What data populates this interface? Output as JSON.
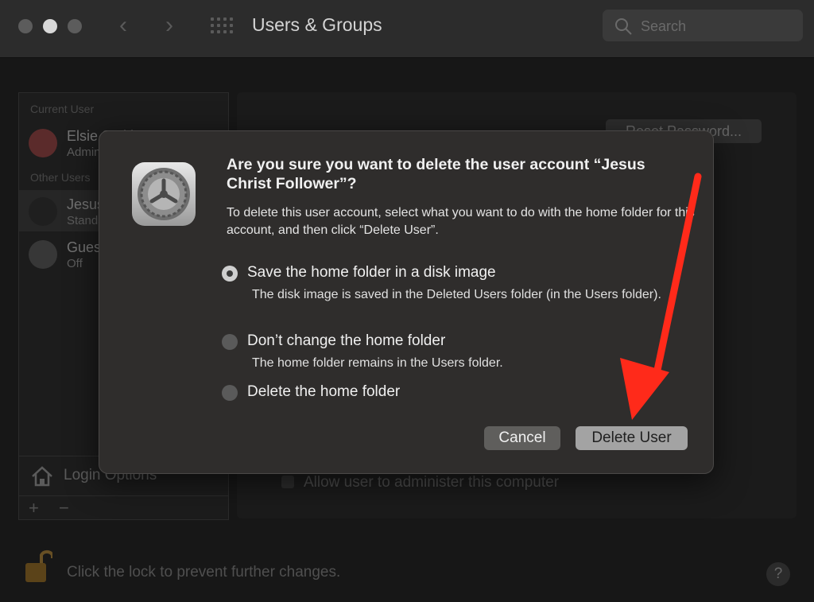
{
  "window": {
    "title": "Users & Groups",
    "search_placeholder": "Search"
  },
  "sidebar": {
    "current_user_label": "Current User",
    "current_user": {
      "name": "Elsie Smith",
      "role": "Admin"
    },
    "other_users_label": "Other Users",
    "other_users": [
      {
        "name": "Jesus Christ Follower",
        "role": "Standard"
      },
      {
        "name": "Guest User",
        "role": "Off"
      }
    ],
    "login_options": "Login Options",
    "add_label": "+",
    "remove_label": "−"
  },
  "panel": {
    "reset_password": "Reset Password...",
    "allow_admin": "Allow user to administer this computer"
  },
  "footer": {
    "lock_text": "Click the lock to prevent further changes.",
    "help": "?"
  },
  "dialog": {
    "title": "Are you sure you want to delete the user account “Jesus Christ Follower”?",
    "description": "To delete this user account, select what you want to do with the home folder for this account, and then click “Delete User”.",
    "options": [
      {
        "label": "Save the home folder in a disk image",
        "description": "The disk image is saved in the Deleted Users folder (in the Users folder).",
        "selected": true
      },
      {
        "label": "Don’t change the home folder",
        "description": "The home folder remains in the Users folder.",
        "selected": false
      },
      {
        "label": "Delete the home folder",
        "description": "",
        "selected": false
      }
    ],
    "cancel_label": "Cancel",
    "delete_label": "Delete User"
  },
  "colors": {
    "annotation_arrow": "#ff2a1a",
    "dialog_bg": "#2f2d2c",
    "window_bg": "#1f1f1f"
  }
}
